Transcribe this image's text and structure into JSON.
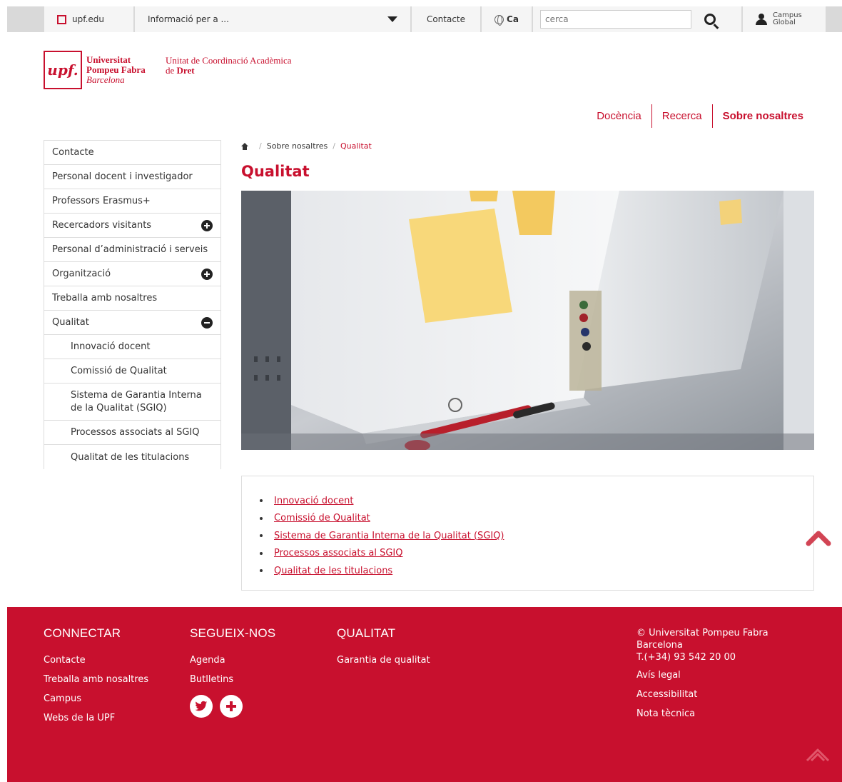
{
  "topbar": {
    "upf_link": "upf.edu",
    "info_dropdown": "Informació per a ...",
    "contact": "Contacte",
    "lang": "Ca",
    "search_placeholder": "cerca",
    "campus_line1": "Campus",
    "campus_line2": "Global"
  },
  "logo": {
    "mark": "upf.",
    "line1": "Universitat",
    "line2": "Pompeu Fabra",
    "line3": "Barcelona",
    "unit_line1": "Unitat de Coordinació Acadèmica",
    "unit_line2_prefix": "de ",
    "unit_line2_bold": "Dret"
  },
  "mainnav": [
    "Docència",
    "Recerca",
    "Sobre nosaltres"
  ],
  "sidebar": {
    "items": [
      {
        "label": "Contacte"
      },
      {
        "label": "Personal docent i investigador"
      },
      {
        "label": "Professors Erasmus+"
      },
      {
        "label": "Recercadors visitants",
        "toggle": "expand"
      },
      {
        "label": "Personal d’administració i serveis"
      },
      {
        "label": "Organització",
        "toggle": "expand"
      },
      {
        "label": "Treballa amb nosaltres"
      },
      {
        "label": "Qualitat",
        "toggle": "collapse"
      }
    ],
    "subitems": [
      "Innovació docent",
      "Comissió de Qualitat",
      "Sistema de Garantia Interna de la Qualitat (SGIQ)",
      "Processos associats al SGIQ",
      "Qualitat de les titulacions"
    ]
  },
  "breadcrumb": {
    "parent": "Sobre nosaltres",
    "separator": "/",
    "current": "Qualitat"
  },
  "page_title": "Qualitat",
  "links": [
    "Innovació docent",
    "Comissió de Qualitat",
    "Sistema de Garantia Interna de la Qualitat (SGIQ)",
    "Processos associats al SGIQ",
    "Qualitat de les titulacions"
  ],
  "footer": {
    "connectar": {
      "title": "CONNECTAR",
      "items": [
        "Contacte",
        "Treballa amb nosaltres",
        "Campus",
        "Webs de la UPF"
      ]
    },
    "segueix": {
      "title": "SEGUEIX-NOS",
      "items": [
        "Agenda",
        "Butlletins"
      ]
    },
    "qualitat": {
      "title": "QUALITAT",
      "items": [
        "Garantia de qualitat"
      ]
    },
    "info": {
      "copyright": "© Universitat Pompeu Fabra",
      "city": "Barcelona",
      "phone": "T.(+34) 93 542 20 00",
      "items": [
        "Avís legal",
        "Accessibilitat",
        "Nota tècnica"
      ]
    }
  },
  "colors": {
    "brand": "#c8102e",
    "topbar_bg": "#d9d9d9"
  }
}
